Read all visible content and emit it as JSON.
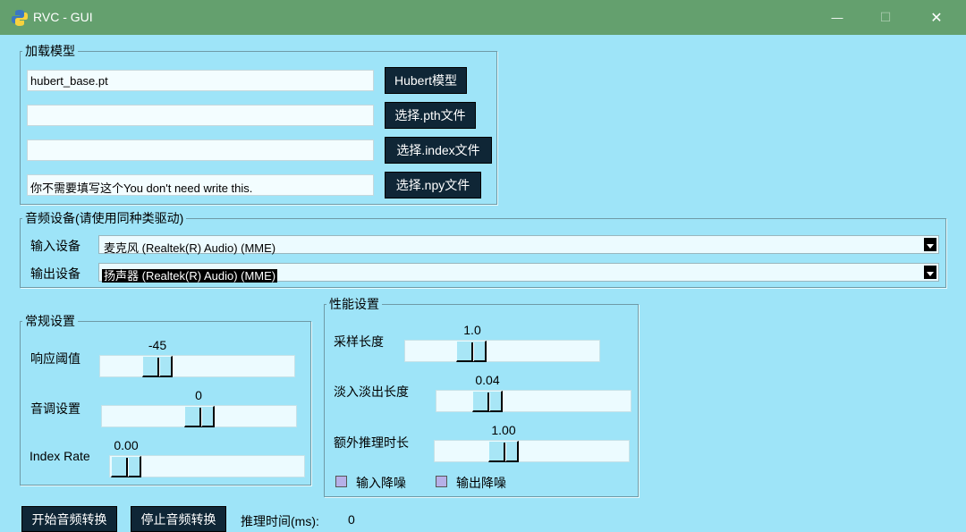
{
  "window": {
    "title": "RVC - GUI",
    "minimize_glyph": "—",
    "maximize_glyph": "☐",
    "close_glyph": "✕"
  },
  "load_model": {
    "legend": "加载模型",
    "hubert_path": "hubert_base.pt",
    "hubert_button": "Hubert模型",
    "pth_path": "",
    "pth_button": "选择.pth文件",
    "index_path": "",
    "index_button": "选择.index文件",
    "npy_path": "你不需要填写这个You don't need write this.",
    "npy_button": "选择.npy文件"
  },
  "audio_device": {
    "legend": "音频设备(请使用同种类驱动)",
    "input_label": "输入设备",
    "input_value": "麦克风 (Realtek(R) Audio) (MME)",
    "output_label": "输出设备",
    "output_value": "扬声器 (Realtek(R) Audio) (MME)"
  },
  "general": {
    "legend": "常规设置",
    "threshold_label": "响应阈值",
    "threshold_value": "-45",
    "pitch_label": "音调设置",
    "pitch_value": "0",
    "index_rate_label": "Index Rate",
    "index_rate_value": "0.00"
  },
  "performance": {
    "legend": "性能设置",
    "sample_length_label": "采样长度",
    "sample_length_value": "1.0",
    "crossfade_label": "淡入淡出长度",
    "crossfade_value": "0.04",
    "extra_time_label": "额外推理时长",
    "extra_time_value": "1.00",
    "input_denoise_label": "输入降噪",
    "output_denoise_label": "输出降噪"
  },
  "controls": {
    "start_button": "开始音频转换",
    "stop_button": "停止音频转换",
    "infer_time_label": "推理时间(ms):",
    "infer_time_value": "0"
  },
  "colors": {
    "background": "#9ee4f8",
    "titlebar": "#64a06e",
    "button_bg": "#0f2636",
    "checkbox": "#b6b0e8"
  },
  "icons": {
    "app": "python-logo-icon"
  }
}
